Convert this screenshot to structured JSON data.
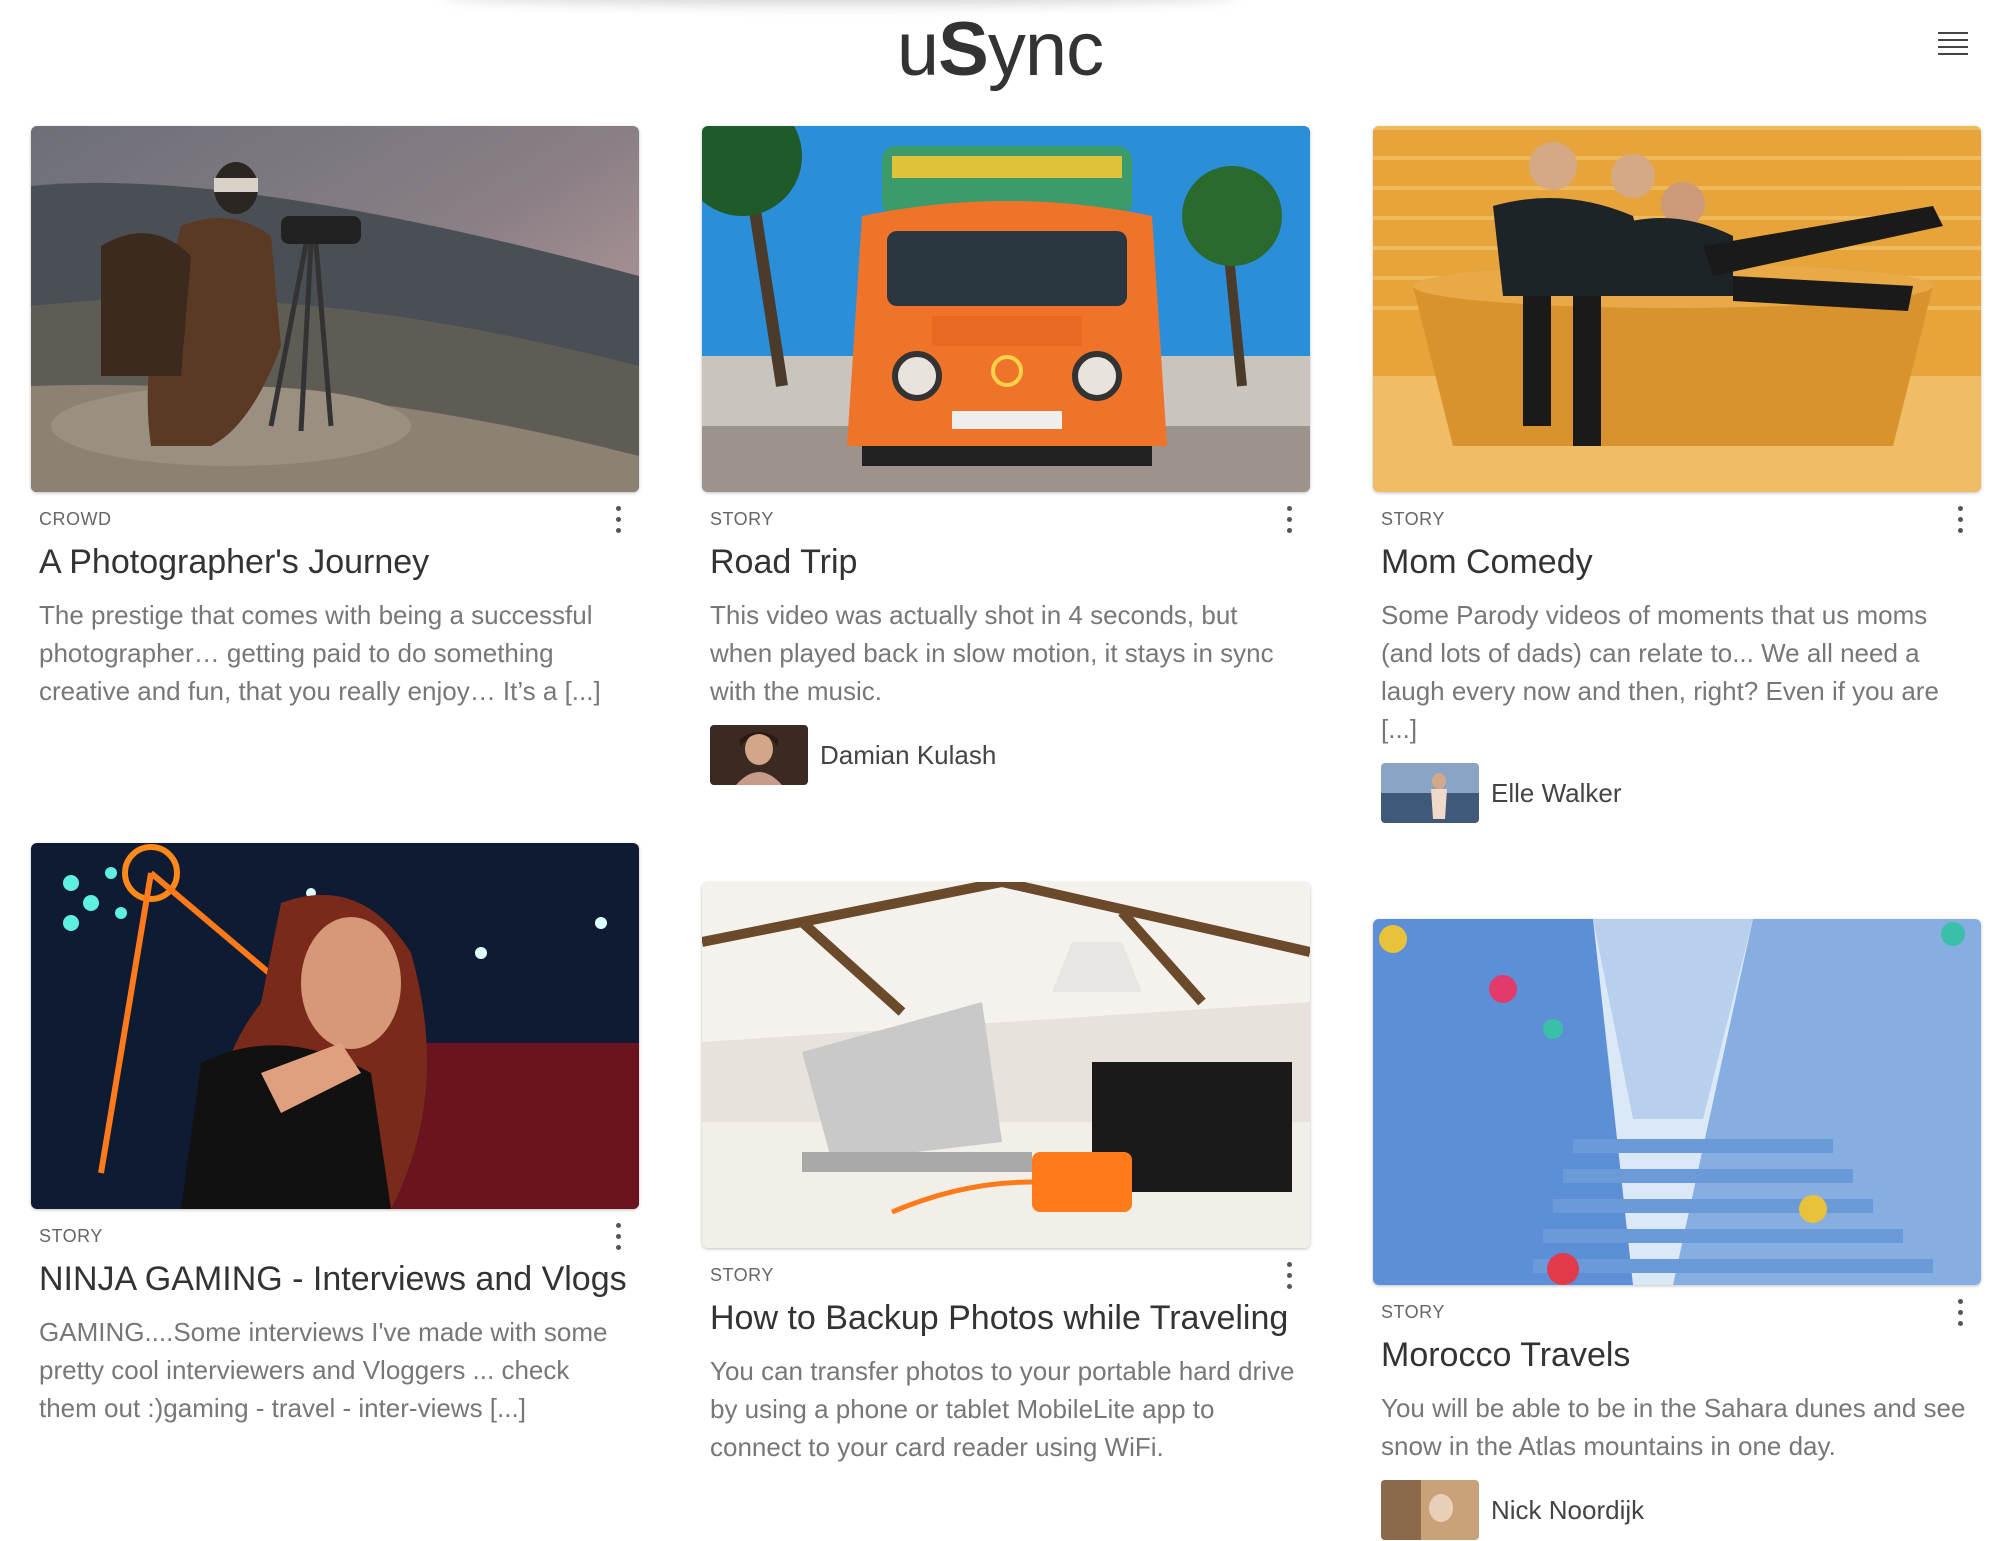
{
  "header": {
    "logo_prefix": "u",
    "logo_bold": "S",
    "logo_suffix": "ync"
  },
  "cards": [
    {
      "category": "CROWD",
      "title": "A Photographer's Journey",
      "description": "The prestige that comes with being a successful photographer… getting paid to do something creative and fun, that you really enjoy… It’s a [...]"
    },
    {
      "category": "STORY",
      "title": "Road Trip",
      "description": "This video was actually shot in 4 seconds, but when played back in slow motion, it stays in sync with the music.",
      "author": "Damian Kulash"
    },
    {
      "category": "STORY",
      "title": "Mom Comedy",
      "description": "Some Parody videos of moments that us moms (and lots of dads) can relate to... We all need a laugh every now and then, right? Even if you are [...]",
      "author": "Elle Walker"
    },
    {
      "category": "STORY",
      "title": "NINJA GAMING - Interviews and Vlogs",
      "description": "GAMING....Some interviews I've made with some pretty cool interviewers and Vloggers ... check them out :)gaming   -   travel   -   inter-views   [...]"
    },
    {
      "category": "STORY",
      "title": "How to Backup Photos while Traveling",
      "description": "You can transfer photos to your portable hard drive by using a phone or tablet MobileLite app to connect to your card reader using WiFi."
    },
    {
      "category": "STORY",
      "title": "Morocco Travels",
      "description": "You will be able to be in the Sahara dunes and see snow in the Atlas mountains in one day.",
      "author": "Nick Noordijk"
    }
  ]
}
